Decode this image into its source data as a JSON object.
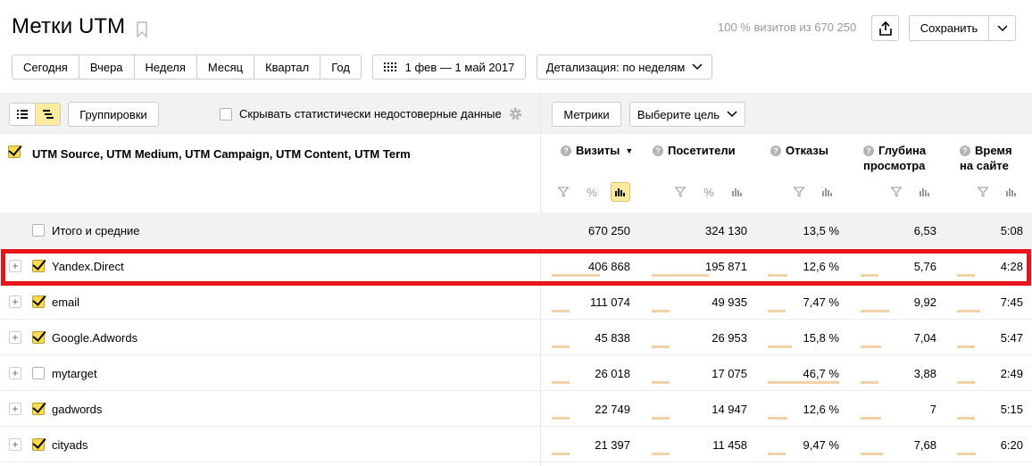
{
  "header": {
    "title": "Метки UTM",
    "visits_info": "100 % визитов из 670 250",
    "save_label": "Сохранить"
  },
  "periods": [
    "Сегодня",
    "Вчера",
    "Неделя",
    "Месяц",
    "Квартал",
    "Год"
  ],
  "date_range": "1 фев — 1 май 2017",
  "detail_label": "Детализация: по неделям",
  "toolbar": {
    "groupings_label": "Группировки",
    "hide_label": "Скрывать статистически недостоверные данные",
    "metrics_label": "Метрики",
    "goal_label": "Выберите цель"
  },
  "table": {
    "dimensions_label": "UTM Source, UTM Medium, UTM Campaign, UTM Content, UTM Term",
    "columns": {
      "visits": "Визиты",
      "visitors": "Посетители",
      "bounce": "Отказы",
      "depth_1": "Глубина",
      "depth_2": "просмотра",
      "time_1": "Время",
      "time_2": "на сайте"
    },
    "totals": {
      "label": "Итого и средние",
      "visits": "670 250",
      "visitors": "324 130",
      "bounce": "13,5 %",
      "depth": "6,53",
      "time": "5:08"
    },
    "rows": [
      {
        "name": "Yandex.Direct",
        "checked": true,
        "visits": "406 868",
        "visitors": "195 871",
        "bounce": "12,6 %",
        "depth": "5,76",
        "time": "4:28",
        "share": [
          0.61,
          0.6,
          0.27,
          0.22,
          0.2
        ]
      },
      {
        "name": "email",
        "checked": true,
        "visits": "111 074",
        "visitors": "49 935",
        "bounce": "7,47 %",
        "depth": "9,92",
        "time": "7:45",
        "share": [
          0.17,
          0.15,
          0.16,
          0.38,
          0.35
        ]
      },
      {
        "name": "Google.Adwords",
        "checked": true,
        "visits": "45 838",
        "visitors": "26 953",
        "bounce": "15,8 %",
        "depth": "7,04",
        "time": "5:47",
        "share": [
          0.07,
          0.08,
          0.34,
          0.27,
          0.26
        ]
      },
      {
        "name": "mytarget",
        "checked": false,
        "visits": "26 018",
        "visitors": "17 075",
        "bounce": "46,7 %",
        "depth": "3,88",
        "time": "2:49",
        "share": [
          0.04,
          0.05,
          1.0,
          0.15,
          0.13
        ]
      },
      {
        "name": "gadwords",
        "checked": true,
        "visits": "22 749",
        "visitors": "14 947",
        "bounce": "12,6 %",
        "depth": "7",
        "time": "5:15",
        "share": [
          0.035,
          0.045,
          0.27,
          0.27,
          0.24
        ]
      },
      {
        "name": "cityads",
        "checked": true,
        "visits": "21 397",
        "visitors": "11 458",
        "bounce": "9,47 %",
        "depth": "7,68",
        "time": "6:20",
        "share": [
          0.033,
          0.035,
          0.2,
          0.29,
          0.29
        ]
      }
    ]
  }
}
